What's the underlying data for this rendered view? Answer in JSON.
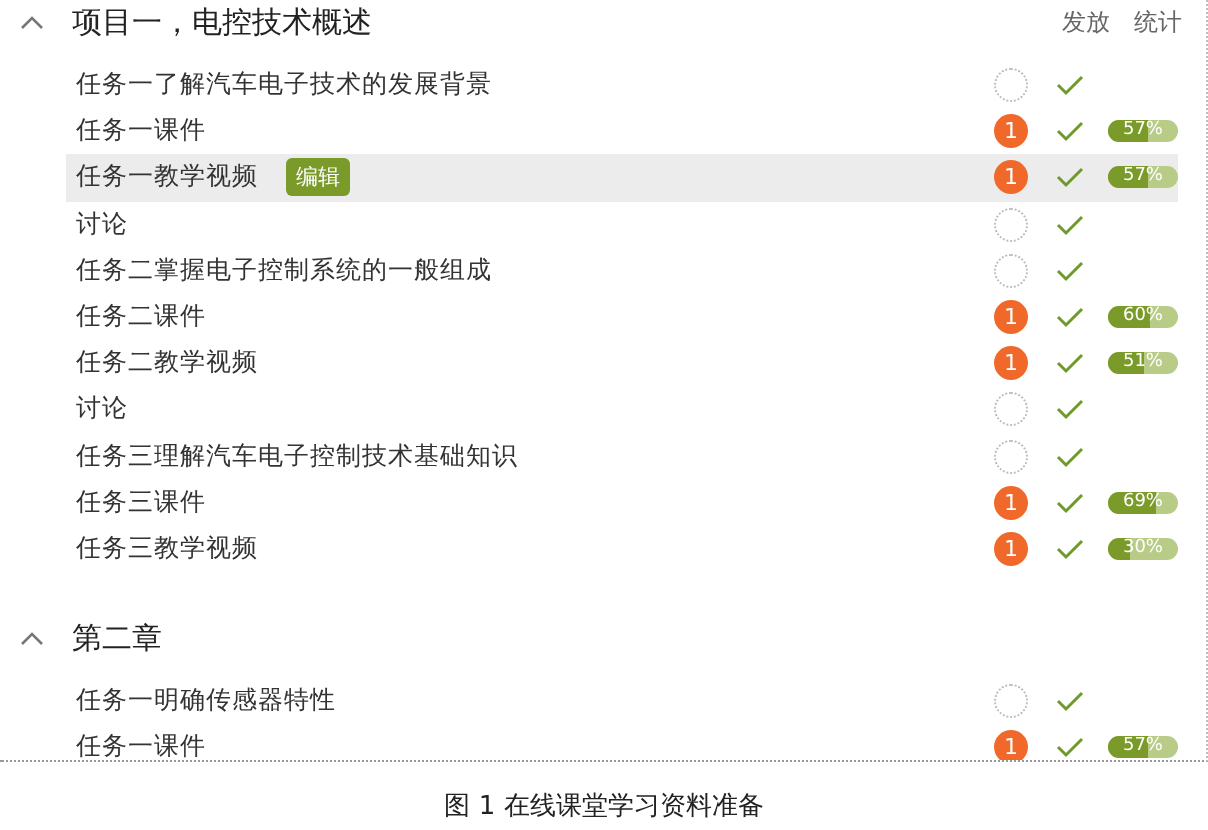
{
  "columns": [
    "发放",
    "统计"
  ],
  "chapters": [
    {
      "title": "项目一，电控技术概述",
      "expanded": true,
      "items": [
        {
          "title": "任务一了解汽车电子技术的发展背景",
          "selected": false,
          "published": true
        },
        {
          "title": "任务一课件",
          "selected": false,
          "published": true,
          "badge": "1",
          "stat": "57%",
          "level": 0.57
        },
        {
          "title": "任务一教学视频",
          "selected": true,
          "edit_label": "编辑",
          "published": true,
          "badge": "1",
          "stat": "57%",
          "level": 0.57
        },
        {
          "title": "讨论",
          "selected": false,
          "published": true
        },
        {
          "title": "任务二掌握电子控制系统的一般组成",
          "selected": false,
          "published": true
        },
        {
          "title": "任务二课件",
          "selected": false,
          "published": true,
          "badge": "1",
          "stat": "60%",
          "level": 0.6
        },
        {
          "title": "任务二教学视频",
          "selected": false,
          "published": true,
          "badge": "1",
          "stat": "51%",
          "level": 0.51
        },
        {
          "title": "讨论",
          "selected": false,
          "published": true
        },
        {
          "title": "任务三理解汽车电子控制技术基础知识",
          "selected": false,
          "published": true
        },
        {
          "title": "任务三课件",
          "selected": false,
          "published": true,
          "badge": "1",
          "stat": "69%",
          "level": 0.69
        },
        {
          "title": "任务三教学视频",
          "selected": false,
          "published": true,
          "badge": "1",
          "stat": "30%",
          "level": 0.3
        }
      ]
    },
    {
      "title": "第二章",
      "expanded": true,
      "items": [
        {
          "title": "任务一明确传感器特性",
          "selected": false,
          "published": true
        },
        {
          "title": "任务一课件",
          "selected": false,
          "published": true,
          "badge": "1",
          "stat": "57%",
          "level": 0.57
        }
      ]
    }
  ],
  "caption": "图 1  在线课堂学习资料准备"
}
